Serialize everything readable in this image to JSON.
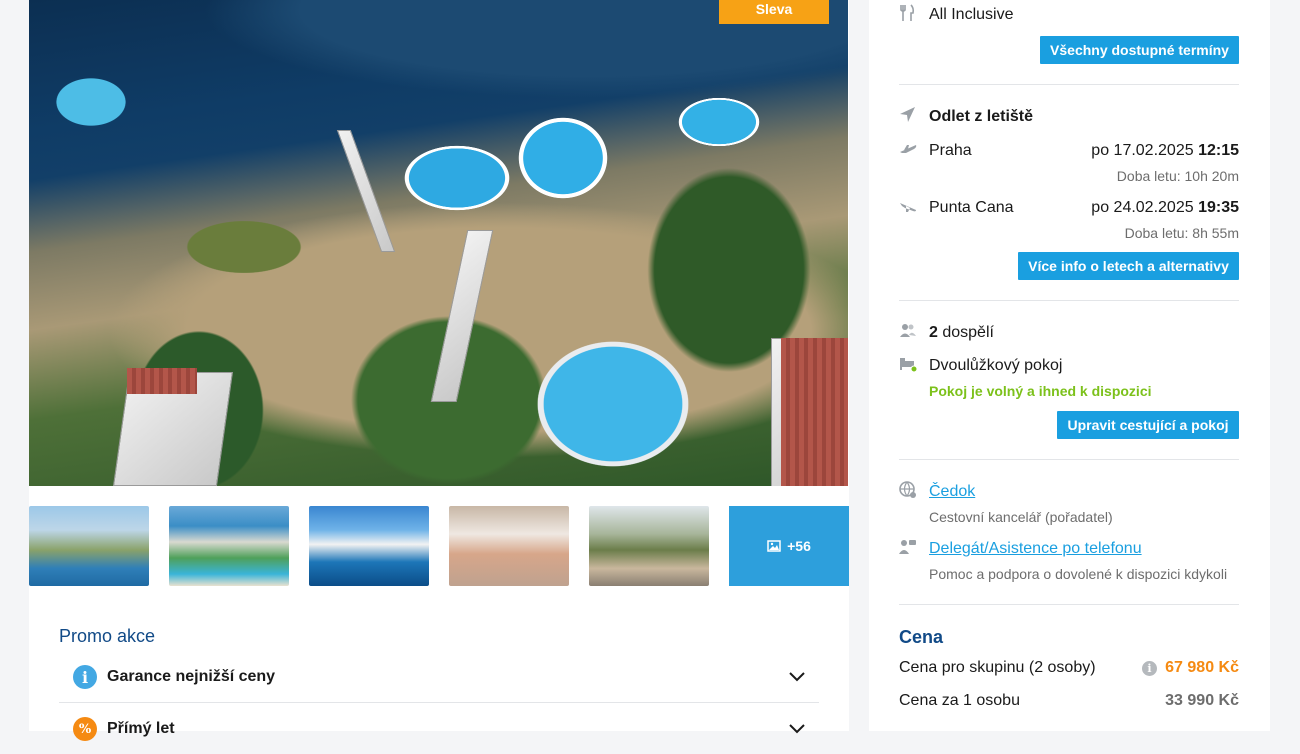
{
  "hero": {
    "badge_label": "Sleva",
    "image_desc": "hotel-resort-aerial-photo"
  },
  "gallery": {
    "more_label": "+56"
  },
  "promo": {
    "title": "Promo akce",
    "items": [
      {
        "label": "Garance nejnižší ceny",
        "icon": "info-icon",
        "color": "#43a8e3"
      },
      {
        "label": "Přímý let",
        "icon": "percent-icon",
        "color": "#f58a12"
      }
    ]
  },
  "sidebar": {
    "board": {
      "label": "All Inclusive",
      "icon": "cutlery-icon"
    },
    "dates_button": "Všechny dostupné termíny",
    "departure_heading": "Odlet z letiště",
    "flights": [
      {
        "city": "Praha",
        "date": "po 17.02.2025",
        "time": "12:15",
        "duration": "Doba letu: 10h 20m",
        "icon": "plane-takeoff-icon"
      },
      {
        "city": "Punta Cana",
        "date": "po 24.02.2025",
        "time": "19:35",
        "duration": "Doba letu: 8h 55m",
        "icon": "plane-landing-icon"
      }
    ],
    "flights_button": "Více info o letech a alternativy",
    "travellers": {
      "count": "2",
      "label": "dospělí"
    },
    "room": {
      "label": "Dvoulůžkový pokoj",
      "availability": "Pokoj je volný a ihned k dispozici"
    },
    "room_button": "Upravit cestující a pokoj",
    "organizer": {
      "name": "Čedok",
      "sub": "Cestovní kancelář (pořadatel)"
    },
    "delegate": {
      "name": "Delegát/Asistence po telefonu",
      "sub": "Pomoc a podpora o dovolené k dispozici kdykoli"
    },
    "price": {
      "title": "Cena",
      "group_label": "Cena pro skupinu (2 osoby)",
      "group_value": "67 980 Kč",
      "person_label": "Cena za 1 osobu",
      "person_value": "33 990 Kč"
    },
    "colors": {
      "accent": "#1a9fe0",
      "price": "#f58a12",
      "available": "#7cc11b",
      "heading": "#114a87"
    }
  }
}
